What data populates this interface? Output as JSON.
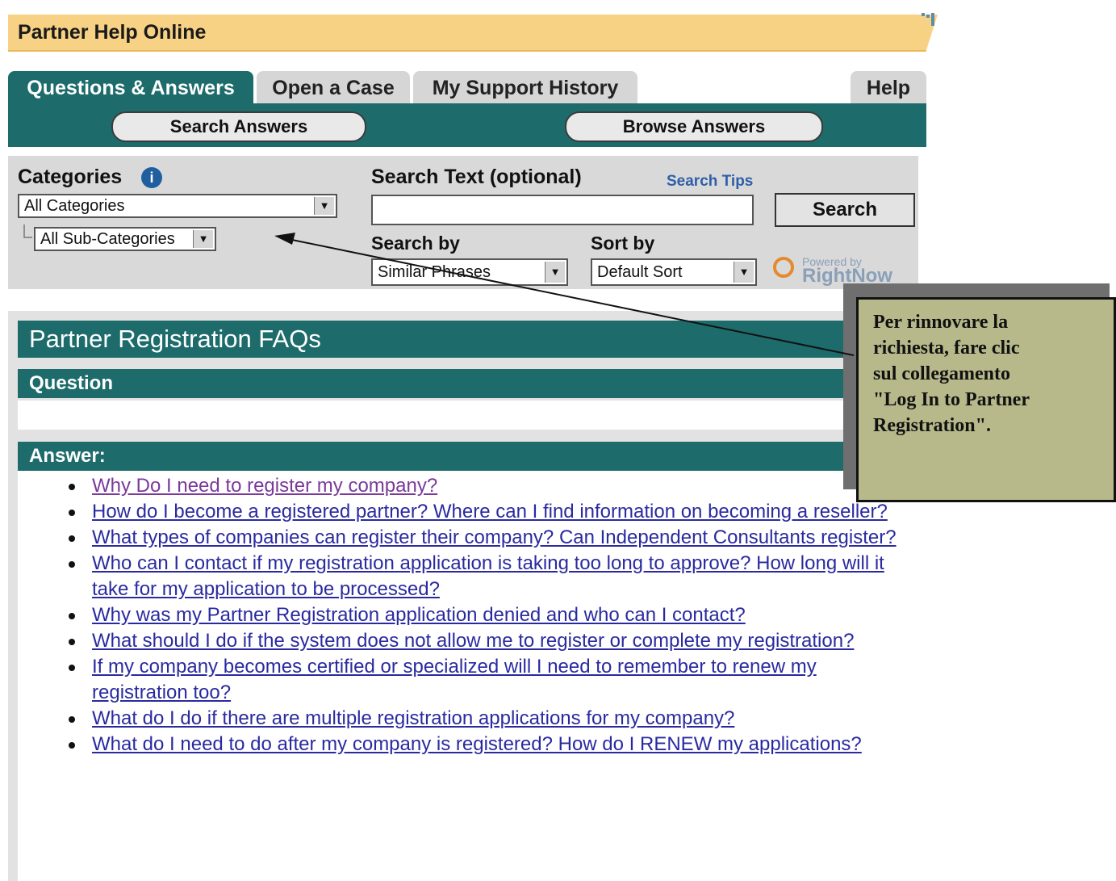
{
  "header": {
    "title": "Partner Help Online"
  },
  "tabs": [
    {
      "label": "Questions & Answers",
      "active": true
    },
    {
      "label": "Open a Case",
      "active": false
    },
    {
      "label": "My Support History",
      "active": false
    },
    {
      "label": "Help",
      "active": false
    }
  ],
  "subnav": {
    "search_answers": "Search Answers",
    "browse_answers": "Browse Answers"
  },
  "search": {
    "categories_label": "Categories",
    "category_value": "All Categories",
    "subcategory_value": "All Sub-Categories",
    "search_text_label": "Search Text (optional)",
    "search_tips": "Search Tips",
    "search_text_value": "",
    "search_button": "Search",
    "search_by_label": "Search by",
    "search_by_value": "Similar Phrases",
    "sort_by_label": "Sort by",
    "sort_by_value": "Default Sort",
    "powered_small": "Powered by",
    "powered_brand": "RightNow"
  },
  "faq": {
    "title": "Partner Registration FAQs",
    "question_header": "Question",
    "answer_header": "Answer:",
    "links": [
      "Why Do I need to register my company?",
      "How do I become a registered partner? Where can I find information on becoming a reseller?",
      "What types of companies can register their company? Can Independent Consultants register?",
      "Who can I contact if my registration application is taking too long to approve? How long will it take for my application to be processed?",
      "Why was my Partner Registration application denied and who can I contact?",
      "What should I do if the system does not allow me to register or complete my registration?",
      "If my company becomes certified or specialized will I need to remember to renew my registration too?",
      "What do I do if there are multiple registration applications for my company?",
      "What do I need to do after my company is registered? How do I RENEW my applications?"
    ]
  },
  "callout": {
    "text": "Per rinnovare la\nrichiesta, fare clic\nsul collegamento\n\"Log In to Partner\nRegistration\"."
  },
  "colors": {
    "teal": "#1d6b6b",
    "banner": "#f8d284",
    "link": "#2a2aa0",
    "callout": "#b7b98a"
  }
}
